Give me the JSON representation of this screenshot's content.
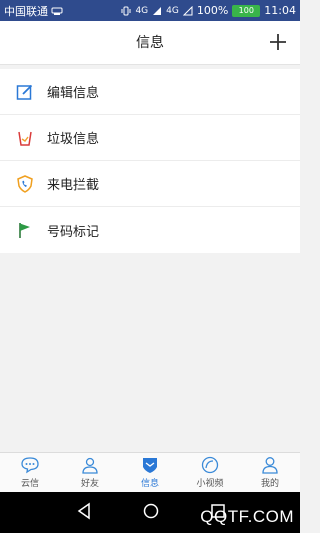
{
  "status_bar": {
    "carrier": "中国联通",
    "network_1": "4G",
    "network_2": "4G",
    "battery": "100%",
    "time": "11:04",
    "battery_badge": "100"
  },
  "header": {
    "title": "信息",
    "add_icon": "plus-icon"
  },
  "menu": {
    "items": [
      {
        "label": "编辑信息",
        "icon": "edit-icon"
      },
      {
        "label": "垃圾信息",
        "icon": "trash-icon"
      },
      {
        "label": "来电拦截",
        "icon": "shield-phone-icon"
      },
      {
        "label": "号码标记",
        "icon": "flag-icon"
      }
    ]
  },
  "tabs": [
    {
      "label": "云信",
      "icon": "chat-bubble-icon"
    },
    {
      "label": "好友",
      "icon": "friends-icon"
    },
    {
      "label": "信息",
      "icon": "shield-message-icon",
      "active": true
    },
    {
      "label": "小视频",
      "icon": "video-icon"
    },
    {
      "label": "我的",
      "icon": "user-icon"
    }
  ],
  "watermark": "QQTF.COM",
  "colors": {
    "status_bar": "#2f4b8d",
    "accent": "#2a78d6",
    "battery": "#39b54a"
  }
}
